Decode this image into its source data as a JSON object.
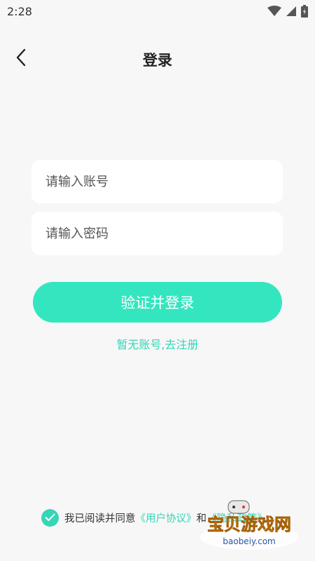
{
  "status_bar": {
    "time": "2:28"
  },
  "header": {
    "title": "登录"
  },
  "form": {
    "account_placeholder": "请输入账号",
    "password_placeholder": "请输入密码",
    "submit_label": "验证并登录",
    "register_link": "暂无账号,去注册"
  },
  "agreement": {
    "prefix": "我已阅读并同意",
    "user_agreement": "《用户协议》",
    "conjunction": "和",
    "privacy_policy": "《隐私政策》"
  },
  "watermark": {
    "name": "宝贝游戏网",
    "domain": "baobeiy.com"
  },
  "colors": {
    "accent": "#34e6c0",
    "accent_text": "#34d6b5",
    "background": "#f7f7f7"
  },
  "icons": [
    "wifi-icon",
    "signal-icon",
    "battery-icon",
    "back-arrow-icon",
    "check-icon"
  ]
}
